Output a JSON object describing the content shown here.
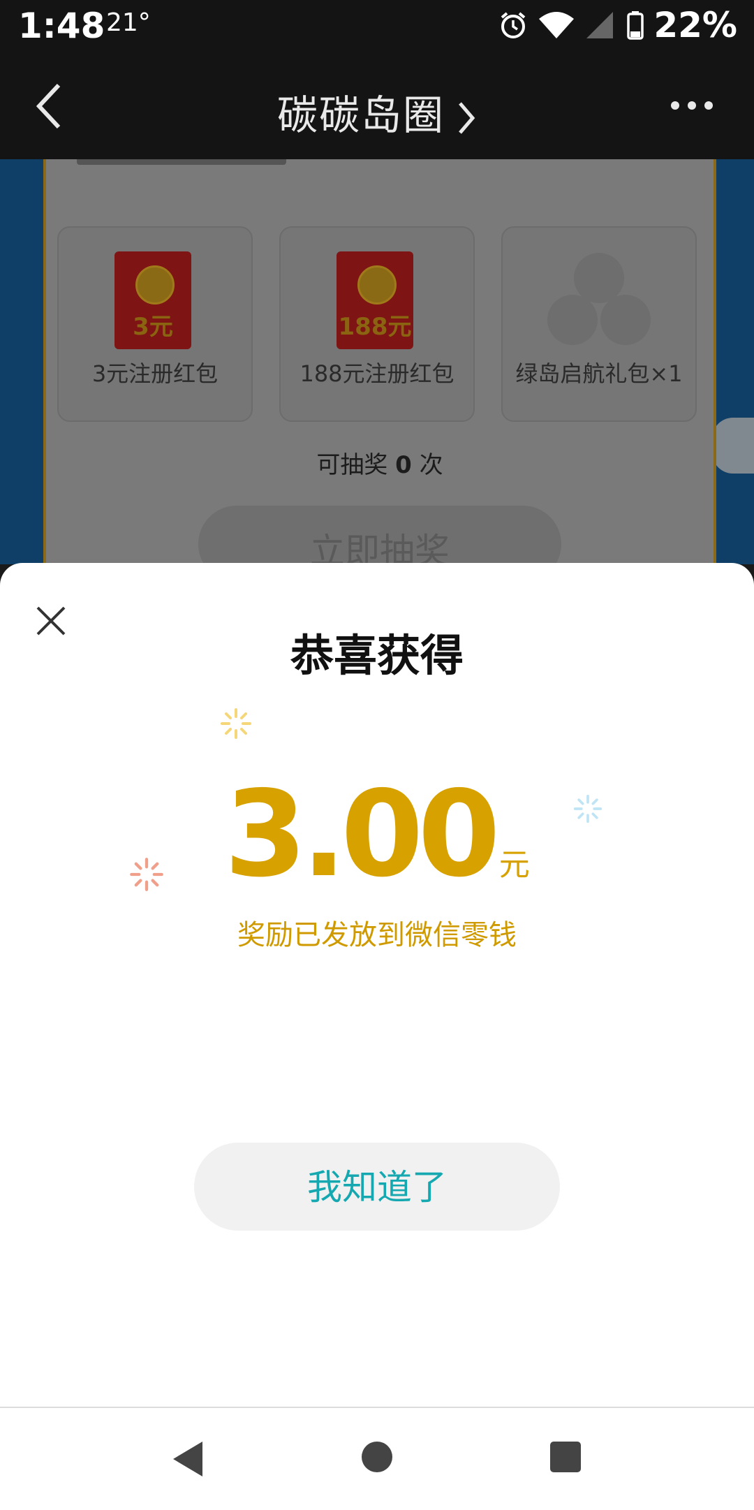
{
  "status_bar": {
    "time": "1:48",
    "temperature": "21°",
    "battery_percent": "22%",
    "icons": [
      "alarm-icon",
      "wifi-icon",
      "signal-icon",
      "battery-icon"
    ]
  },
  "title_bar": {
    "title": "碳碳岛圈",
    "back_icon": "back-arrow-icon",
    "chevron_icon": "chevron-right-icon",
    "more_icon": "more-dots-icon"
  },
  "background_page": {
    "prizes": [
      {
        "label": "3元注册红包",
        "envelope_text": "3元"
      },
      {
        "label": "188元注册红包",
        "envelope_text": "188元"
      },
      {
        "label": "绿岛启航礼包×1"
      }
    ],
    "draw_count_prefix": "可抽奖",
    "draw_count_value": "0",
    "draw_count_suffix": "次",
    "draw_button": "立即抽奖"
  },
  "sheet": {
    "title": "恭喜获得",
    "amount": "3.00",
    "unit": "元",
    "notice": "奖励已发放到微信零钱",
    "confirm_button": "我知道了",
    "close_icon": "close-icon"
  },
  "nav_bar": {
    "icons": [
      "nav-back-icon",
      "nav-home-icon",
      "nav-recents-icon"
    ]
  },
  "colors": {
    "amount": "#d7a200",
    "button_text": "#15a8b0",
    "status_bar_bg": "#141414"
  }
}
